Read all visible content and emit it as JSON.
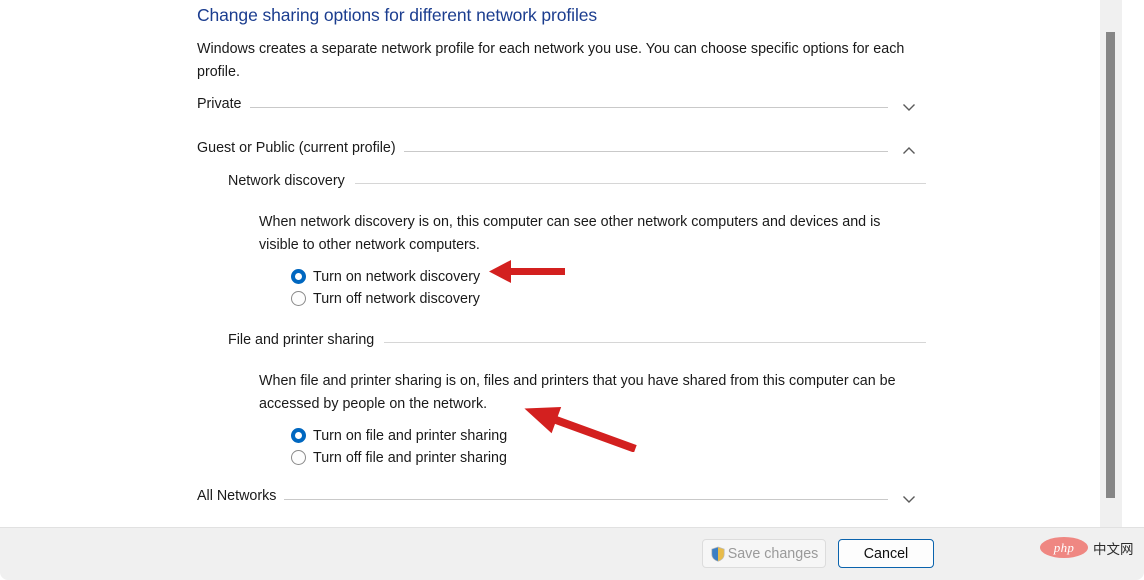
{
  "page": {
    "heading": "Change sharing options for different network profiles",
    "description": "Windows creates a separate network profile for each network you use. You can choose specific options for each profile."
  },
  "profiles": [
    {
      "label": "Private",
      "state": "collapsed",
      "chevron": "chevron-down-icon"
    },
    {
      "label": "Guest or Public (current profile)",
      "state": "expanded",
      "chevron": "chevron-up-icon"
    },
    {
      "label": "All Networks",
      "state": "collapsed",
      "chevron": "chevron-down-icon"
    }
  ],
  "sections": {
    "network_discovery": {
      "title": "Network discovery",
      "description": "When network discovery is on, this computer can see other network computers and devices and is visible to other network computers.",
      "options": [
        {
          "label": "Turn on network discovery",
          "checked": true
        },
        {
          "label": "Turn off network discovery",
          "checked": false
        }
      ]
    },
    "file_printer_sharing": {
      "title": "File and printer sharing",
      "description": "When file and printer sharing is on, files and printers that you have shared from this computer can be accessed by people on the network.",
      "options": [
        {
          "label": "Turn on file and printer sharing",
          "checked": true
        },
        {
          "label": "Turn off file and printer sharing",
          "checked": false
        }
      ]
    }
  },
  "footer": {
    "save_label": "Save changes",
    "save_enabled": false,
    "save_icon": "uac-shield-icon",
    "cancel_label": "Cancel"
  },
  "watermark": {
    "badge": "php",
    "text": "中文网"
  },
  "colors": {
    "heading_blue": "#1b3d8f",
    "radio_accent": "#0067c0",
    "cancel_border": "#0a63ad",
    "arrow_red": "#d3201f",
    "footer_bg": "#f0f0f0",
    "scrollbar_thumb": "#868686",
    "watermark_badge": "#ef8782"
  },
  "scrollbar": {
    "orientation": "vertical",
    "thumb_top_pct": 6,
    "thumb_height_pct": 88
  }
}
